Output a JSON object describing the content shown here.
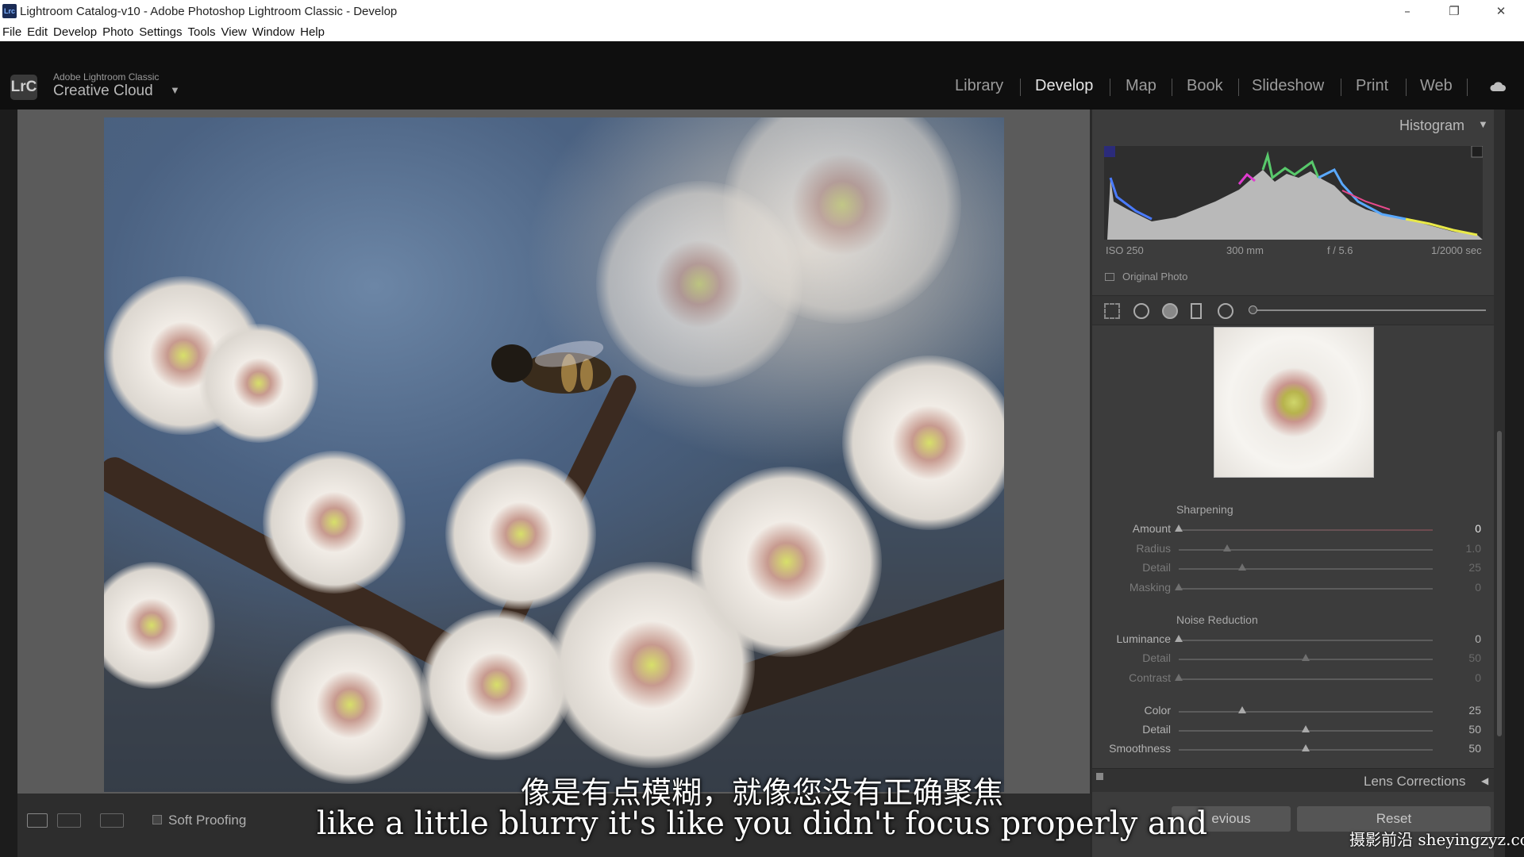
{
  "window": {
    "app_icon": "Lrc",
    "title": "Lightroom Catalog-v10 - Adobe Photoshop Lightroom Classic - Develop",
    "minimize_icon": "minimize-icon",
    "restore_icon": "restore-icon",
    "close_icon": "close-icon"
  },
  "menu": [
    "File",
    "Edit",
    "Develop",
    "Photo",
    "Settings",
    "Tools",
    "View",
    "Window",
    "Help"
  ],
  "identity": {
    "badge": "LrC",
    "small": "Adobe Lightroom Classic",
    "large": "Creative Cloud",
    "caret": "▼"
  },
  "modules": [
    {
      "label": "Library",
      "active": false
    },
    {
      "label": "Develop",
      "active": true
    },
    {
      "label": "Map",
      "active": false
    },
    {
      "label": "Book",
      "active": false
    },
    {
      "label": "Slideshow",
      "active": false
    },
    {
      "label": "Print",
      "active": false
    },
    {
      "label": "Web",
      "active": false
    }
  ],
  "toolbar": {
    "soft_proofing": "Soft Proofing"
  },
  "histogram": {
    "title": "Histogram",
    "caret": "▼",
    "iso": "ISO 250",
    "focal": "300 mm",
    "aperture": "f / 5.6",
    "shutter": "1/2000 sec",
    "original_photo": "Original Photo"
  },
  "sharpening": {
    "title": "Sharpening",
    "rows": [
      {
        "label": "Amount",
        "value": "0",
        "pos": 0.0,
        "active": true
      },
      {
        "label": "Radius",
        "value": "1.0",
        "pos": 0.19,
        "active": false
      },
      {
        "label": "Detail",
        "value": "25",
        "pos": 0.25,
        "active": false
      },
      {
        "label": "Masking",
        "value": "0",
        "pos": 0.0,
        "active": false
      }
    ]
  },
  "noise_reduction": {
    "title": "Noise Reduction",
    "rows": [
      {
        "label": "Luminance",
        "value": "0",
        "pos": 0.0,
        "active": true
      },
      {
        "label": "Detail",
        "value": "50",
        "pos": 0.5,
        "active": false
      },
      {
        "label": "Contrast",
        "value": "0",
        "pos": 0.0,
        "active": false
      },
      {
        "label": "Color",
        "value": "25",
        "pos": 0.25,
        "active": true
      },
      {
        "label": "Detail",
        "value": "50",
        "pos": 0.5,
        "active": true
      },
      {
        "label": "Smoothness",
        "value": "50",
        "pos": 0.5,
        "active": true
      }
    ]
  },
  "lens_corrections": {
    "title": "Lens Corrections",
    "caret": "◀"
  },
  "buttons": {
    "previous": "evious",
    "reset": "Reset"
  },
  "subtitles": {
    "cn": "像是有点模糊，就像您没有正确聚焦",
    "en": "like a little blurry it's like you didn't focus properly and"
  },
  "watermark": "摄影前沿 sheyingzyz.com",
  "colors": {
    "accent_text": "#e6e6e6",
    "panel_bg": "#3c3c3c"
  }
}
